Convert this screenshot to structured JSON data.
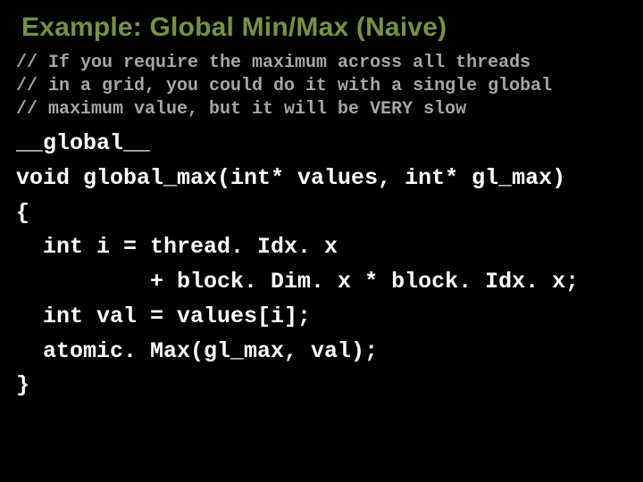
{
  "slide": {
    "title": "Example: Global Min/Max (Naive)",
    "comment_line_1": "// If you require the maximum across all threads",
    "comment_line_2": "// in a grid, you could do it with a single global",
    "comment_line_3": "// maximum value, but it will be VERY slow",
    "code_line_1": "__global__",
    "code_line_2": "void global_max(int* values, int* gl_max)",
    "code_line_3": "{",
    "code_line_4": "  int i = thread. Idx. x",
    "code_line_5": "          + block. Dim. x * block. Idx. x;",
    "code_line_6": "  int val = values[i];",
    "code_line_7": "  atomic. Max(gl_max, val);",
    "code_line_8": "}"
  }
}
